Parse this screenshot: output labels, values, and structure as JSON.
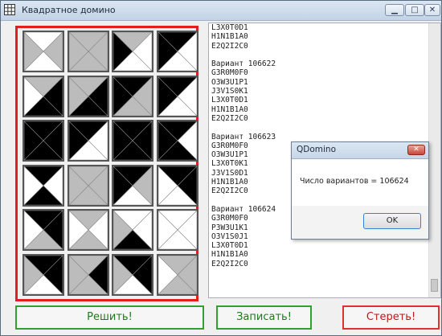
{
  "window": {
    "title": "Квадратное домино"
  },
  "colors": {
    "black": "#000000",
    "gray": "#bcbcbc",
    "white": "#ffffff",
    "boardBorder": "#e02020",
    "green": "#30a030",
    "red": "#e03030"
  },
  "board": {
    "rows": [
      [
        [
          "w",
          "g",
          "w",
          "g"
        ],
        [
          "g",
          "g",
          "g",
          "g"
        ],
        [
          "g",
          "w",
          "w",
          "b"
        ],
        [
          "b",
          "w",
          "w",
          "b"
        ]
      ],
      [
        [
          "g",
          "b",
          "b",
          "w"
        ],
        [
          "g",
          "b",
          "b",
          "g"
        ],
        [
          "b",
          "g",
          "g",
          "b"
        ],
        [
          "b",
          "w",
          "w",
          "b"
        ]
      ],
      [
        [
          "b",
          "b",
          "b",
          "b"
        ],
        [
          "b",
          "w",
          "w",
          "b"
        ],
        [
          "b",
          "b",
          "b",
          "b"
        ],
        [
          "b",
          "w",
          "b",
          "b"
        ]
      ],
      [
        [
          "b",
          "w",
          "b",
          "w"
        ],
        [
          "g",
          "g",
          "g",
          "g"
        ],
        [
          "b",
          "g",
          "w",
          "b"
        ],
        [
          "b",
          "b",
          "w",
          "w"
        ]
      ],
      [
        [
          "b",
          "b",
          "g",
          "w"
        ],
        [
          "g",
          "w",
          "g",
          "w"
        ],
        [
          "w",
          "w",
          "b",
          "g"
        ],
        [
          "w",
          "w",
          "w",
          "w"
        ]
      ],
      [
        [
          "b",
          "b",
          "w",
          "g"
        ],
        [
          "g",
          "b",
          "g",
          "g"
        ],
        [
          "b",
          "b",
          "w",
          "g"
        ],
        [
          "g",
          "g",
          "g",
          "w"
        ]
      ]
    ]
  },
  "output": {
    "lines": [
      "L3X0T0D1",
      "H1N1B1A0",
      "E2Q2I2C0",
      "",
      "Вариант 106622",
      "G3R0M0F0",
      "O3W3U1P1",
      "J3V1S0K1",
      "L3X0T0D1",
      "H1N1B1A0",
      "E2Q2I2C0",
      "",
      "Вариант 106623",
      "G3R0M0F0",
      "O3W3U1P1",
      "L3X0T0K1",
      "J3V1S0D1",
      "H1N1B1A0",
      "E2Q2I2C0",
      "",
      "Вариант 106624",
      "G3R0M0F0",
      "P3W3U1K1",
      "O3V1S0J1",
      "L3X0T0D1",
      "H1N1B1A0",
      "E2Q2I2C0"
    ]
  },
  "dialog": {
    "title": "QDomino",
    "message": "Число вариантов = 106624",
    "ok_label": "OK",
    "close_icon": "close-icon"
  },
  "buttons": {
    "solve": "Решить!",
    "write": "Записать!",
    "erase": "Стереть!"
  }
}
